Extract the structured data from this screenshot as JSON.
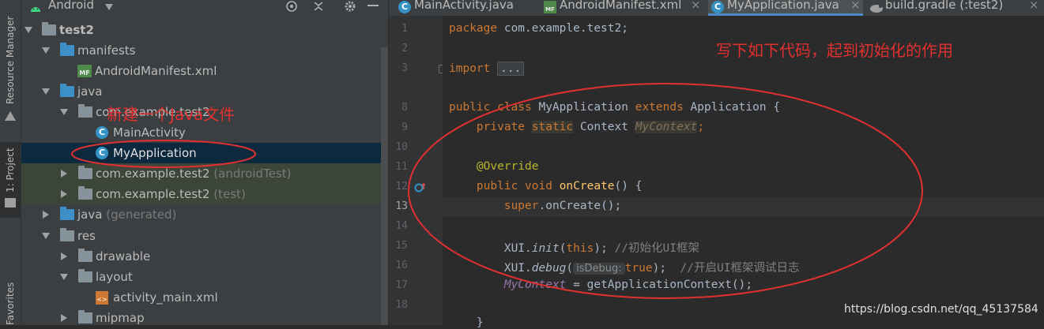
{
  "sidebar_strip": {
    "resource_manager": "Resource Manager",
    "project": "1: Project",
    "favorites": "Favorites"
  },
  "project_panel": {
    "view_selector": "Android",
    "rows": [
      {
        "label": "test2",
        "dim": ""
      },
      {
        "label": "manifests",
        "dim": ""
      },
      {
        "label": "AndroidManifest.xml",
        "dim": ""
      },
      {
        "label": "java",
        "dim": ""
      },
      {
        "label": "com.example.test2",
        "dim": ""
      },
      {
        "label": "MainActivity",
        "dim": ""
      },
      {
        "label": "MyApplication",
        "dim": ""
      },
      {
        "label": "com.example.test2",
        "dim": "(androidTest)"
      },
      {
        "label": "com.example.test2",
        "dim": "(test)"
      },
      {
        "label": "java",
        "dim": "(generated)"
      },
      {
        "label": "res",
        "dim": ""
      },
      {
        "label": "drawable",
        "dim": ""
      },
      {
        "label": "layout",
        "dim": ""
      },
      {
        "label": "activity_main.xml",
        "dim": ""
      },
      {
        "label": "mipmap",
        "dim": ""
      }
    ],
    "annotation": "新建一个Java文件"
  },
  "tabs": [
    {
      "label": "MainActivity.java",
      "icon": "C"
    },
    {
      "label": "AndroidManifest.xml",
      "icon": "MF"
    },
    {
      "label": "MyApplication.java",
      "icon": "C"
    },
    {
      "label": "build.gradle (:test2)",
      "icon": "gradle"
    }
  ],
  "editor": {
    "line_numbers": [
      "1",
      "2",
      "3",
      "8",
      "9",
      "10",
      "11",
      "12",
      "13",
      "14",
      "15",
      "16",
      "17",
      "18"
    ],
    "code": {
      "l1_kw": "package",
      "l1_rest": " com.example.test2;",
      "l3_kw": "import",
      "l3_fold": "...",
      "l8_a": "public class",
      "l8_b": " MyApplication ",
      "l8_c": "extends",
      "l8_d": " Application {",
      "l9_a": "private",
      "l9_b": "static",
      "l9_c": " Context ",
      "l9_d": "MyContext",
      "l9_e": ";",
      "l11": "@Override",
      "l12_a": "public void",
      "l12_b": "onCreate",
      "l12_c": "() {",
      "l13_a": "super",
      "l13_b": ".onCreate();",
      "l15_a": "XUI.",
      "l15_b": "init",
      "l15_c": "(",
      "l15_d": "this",
      "l15_e": "); ",
      "l15_f": "//初始化UI框架",
      "l16_a": "XUI.",
      "l16_b": "debug",
      "l16_c": "(",
      "l16_hint": "isDebug:",
      "l16_d": "true",
      "l16_e": ");  ",
      "l16_f": "//开启UI框架调试日志",
      "l17_a": "MyContext",
      "l17_b": " = getApplicationContext();",
      "l19": "}"
    },
    "annotation": "写下如下代码，起到初始化的作用"
  },
  "watermark": "https://blog.csdn.net/qq_45137584",
  "colors": {
    "annotation": "#e03030",
    "accent": "#4a88c7"
  }
}
